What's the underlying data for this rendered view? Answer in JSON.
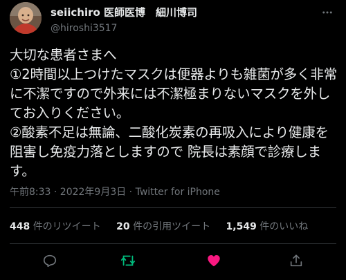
{
  "author": {
    "display_name": "seiichiro 医師医博　細川博司",
    "handle": "@hiroshi3517",
    "avatar_icon": "user-avatar"
  },
  "tweet": {
    "text": "大切な患者さまへ\n①2時間以上つけたマスクは便器よりも雑菌が多く非常に不潔ですので外来には不潔極まりないマスクを外してお入りください。\n②酸素不足は無論、二酸化炭素の再吸入により健康を阻害し免疫力落としますので 院長は素顔で診療します。",
    "timestamp": "午前8:33 · 2022年9月3日 · Twitter for iPhone"
  },
  "stats": {
    "retweets": {
      "count": "448",
      "label": "件のリツイート"
    },
    "quotes": {
      "count": "20",
      "label": "件の引用ツイート"
    },
    "likes": {
      "count": "1,549",
      "label": "件のいいね"
    }
  },
  "actions": {
    "reply_icon": "reply-icon",
    "retweet_icon": "retweet-icon",
    "like_icon": "heart-icon",
    "share_icon": "share-icon"
  },
  "colors": {
    "background": "#000000",
    "text": "#e7e9ea",
    "secondary": "#71767b",
    "retweet_active": "#00ba7c",
    "like_active": "#f91880",
    "divider": "#2f3336"
  }
}
